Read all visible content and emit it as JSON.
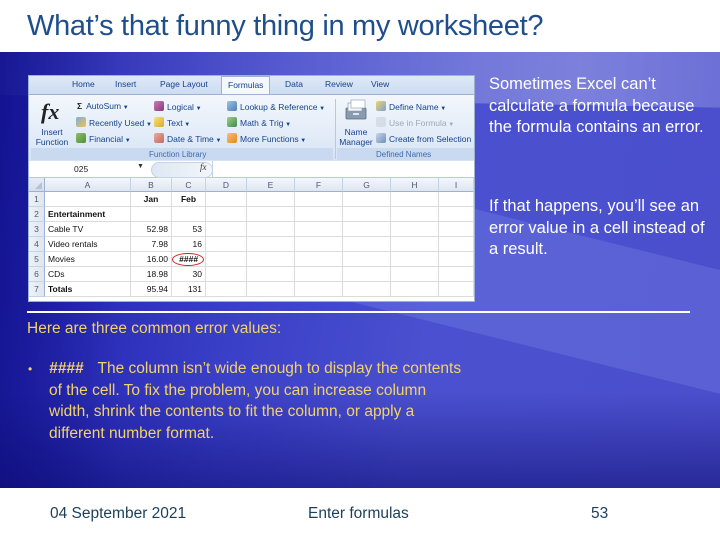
{
  "slide": {
    "title": "What’s that funny thing in my worksheet?",
    "side_paragraphs": [
      "Sometimes Excel can’t calculate a formula because the formula contains an error.",
      "If that happens, you’ll see an error value in a cell instead of a result."
    ],
    "intro": "Here are three common error values:",
    "bullets": [
      {
        "code": "####",
        "text": "The column isn’t wide enough to display the contents of the cell. To fix the problem, you can increase column width, shrink the contents to fit the column, or apply a different number format."
      }
    ],
    "colors": {
      "title": "#1f4e8c",
      "body_highlight": "#f2d36a",
      "side_text": "#ffffff",
      "error_circle": "#c0282b"
    }
  },
  "footer": {
    "date": "04 September 2021",
    "topic": "Enter formulas",
    "page_number": "53"
  },
  "excel": {
    "tabs": [
      "Home",
      "Insert",
      "Page Layout",
      "Formulas",
      "Data",
      "Review",
      "View"
    ],
    "active_tab": "Formulas",
    "ribbon": {
      "insert_function": {
        "icon": "fx-icon",
        "label_line1": "Insert",
        "label_line2": "Function"
      },
      "function_library": {
        "label": "Function Library",
        "items": [
          {
            "label": "AutoSum",
            "icon": "sigma-icon",
            "dropdown": true
          },
          {
            "label": "Recently Used",
            "icon": "star-book-icon",
            "dropdown": true
          },
          {
            "label": "Financial",
            "icon": "financial-book-icon",
            "dropdown": true
          },
          {
            "label": "Logical",
            "icon": "logical-book-icon",
            "dropdown": true
          },
          {
            "label": "Text",
            "icon": "text-book-icon",
            "dropdown": true
          },
          {
            "label": "Date & Time",
            "icon": "datetime-book-icon",
            "dropdown": true
          },
          {
            "label": "Lookup & Reference",
            "icon": "lookup-book-icon",
            "dropdown": true
          },
          {
            "label": "Math & Trig",
            "icon": "math-book-icon",
            "dropdown": true
          },
          {
            "label": "More Functions",
            "icon": "more-functions-book-icon",
            "dropdown": true
          }
        ]
      },
      "defined_names": {
        "label": "Defined Names",
        "name_manager": {
          "label_line1": "Name",
          "label_line2": "Manager"
        },
        "items": [
          {
            "label": "Define Name",
            "icon": "define-name-icon",
            "dropdown": true,
            "enabled": true
          },
          {
            "label": "Use in Formula",
            "icon": "use-in-formula-icon",
            "dropdown": true,
            "enabled": false
          },
          {
            "label": "Create from Selection",
            "icon": "create-from-selection-icon",
            "dropdown": false,
            "enabled": true
          }
        ]
      }
    },
    "name_box": "025",
    "formula_bar_value": "",
    "columns": [
      "A",
      "B",
      "C",
      "D",
      "E",
      "F",
      "G",
      "H",
      "I"
    ],
    "rows": [
      {
        "num": "1",
        "cells": [
          "",
          "Jan",
          "Feb"
        ]
      },
      {
        "num": "2",
        "cells": [
          "Entertainment",
          "",
          ""
        ]
      },
      {
        "num": "3",
        "cells": [
          "Cable TV",
          "52.98",
          "53"
        ]
      },
      {
        "num": "4",
        "cells": [
          "Video rentals",
          "7.98",
          "16"
        ]
      },
      {
        "num": "5",
        "cells": [
          "Movies",
          "16.00",
          "####"
        ]
      },
      {
        "num": "6",
        "cells": [
          "CDs",
          "18.98",
          "30"
        ]
      },
      {
        "num": "7",
        "cells": [
          "Totals",
          "95.94",
          "131"
        ]
      }
    ]
  }
}
